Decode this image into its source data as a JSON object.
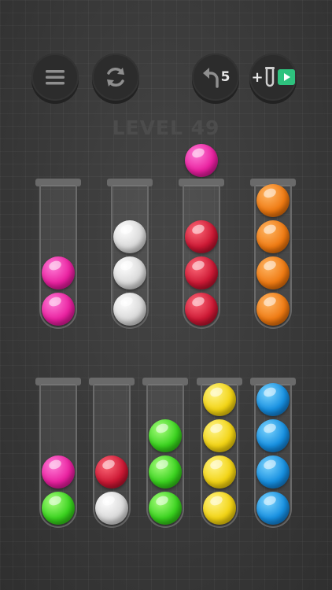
{
  "header": {
    "level_label": "LEVEL 49",
    "undo_count": "5",
    "add_tube_label": "+"
  },
  "buttons": [
    {
      "name": "menu",
      "icon": "menu-icon"
    },
    {
      "name": "restart",
      "icon": "restart-icon"
    },
    {
      "name": "undo",
      "icon": "undo-icon"
    },
    {
      "name": "add-tube",
      "icon": "add-tube-icon"
    }
  ],
  "lifted_ball": "pink",
  "colors": {
    "pink": "#e9209f",
    "white": "#d9d9d9",
    "red": "#cc1834",
    "orange": "#ef7a12",
    "green": "#39d21e",
    "yellow": "#f2d313",
    "blue": "#168fe0"
  },
  "tubes_top_row": [
    {
      "balls": [
        "pink",
        "pink"
      ]
    },
    {
      "balls": [
        "white",
        "white",
        "white"
      ]
    },
    {
      "balls": [
        "red",
        "red",
        "red"
      ]
    },
    {
      "balls": [
        "orange",
        "orange",
        "orange",
        "orange"
      ]
    }
  ],
  "tubes_bottom_row": [
    {
      "balls": [
        "green",
        "pink"
      ]
    },
    {
      "balls": [
        "white",
        "red"
      ]
    },
    {
      "balls": [
        "green",
        "green",
        "green"
      ]
    },
    {
      "balls": [
        "yellow",
        "yellow",
        "yellow",
        "yellow"
      ]
    },
    {
      "balls": [
        "blue",
        "blue",
        "blue",
        "blue"
      ]
    }
  ]
}
